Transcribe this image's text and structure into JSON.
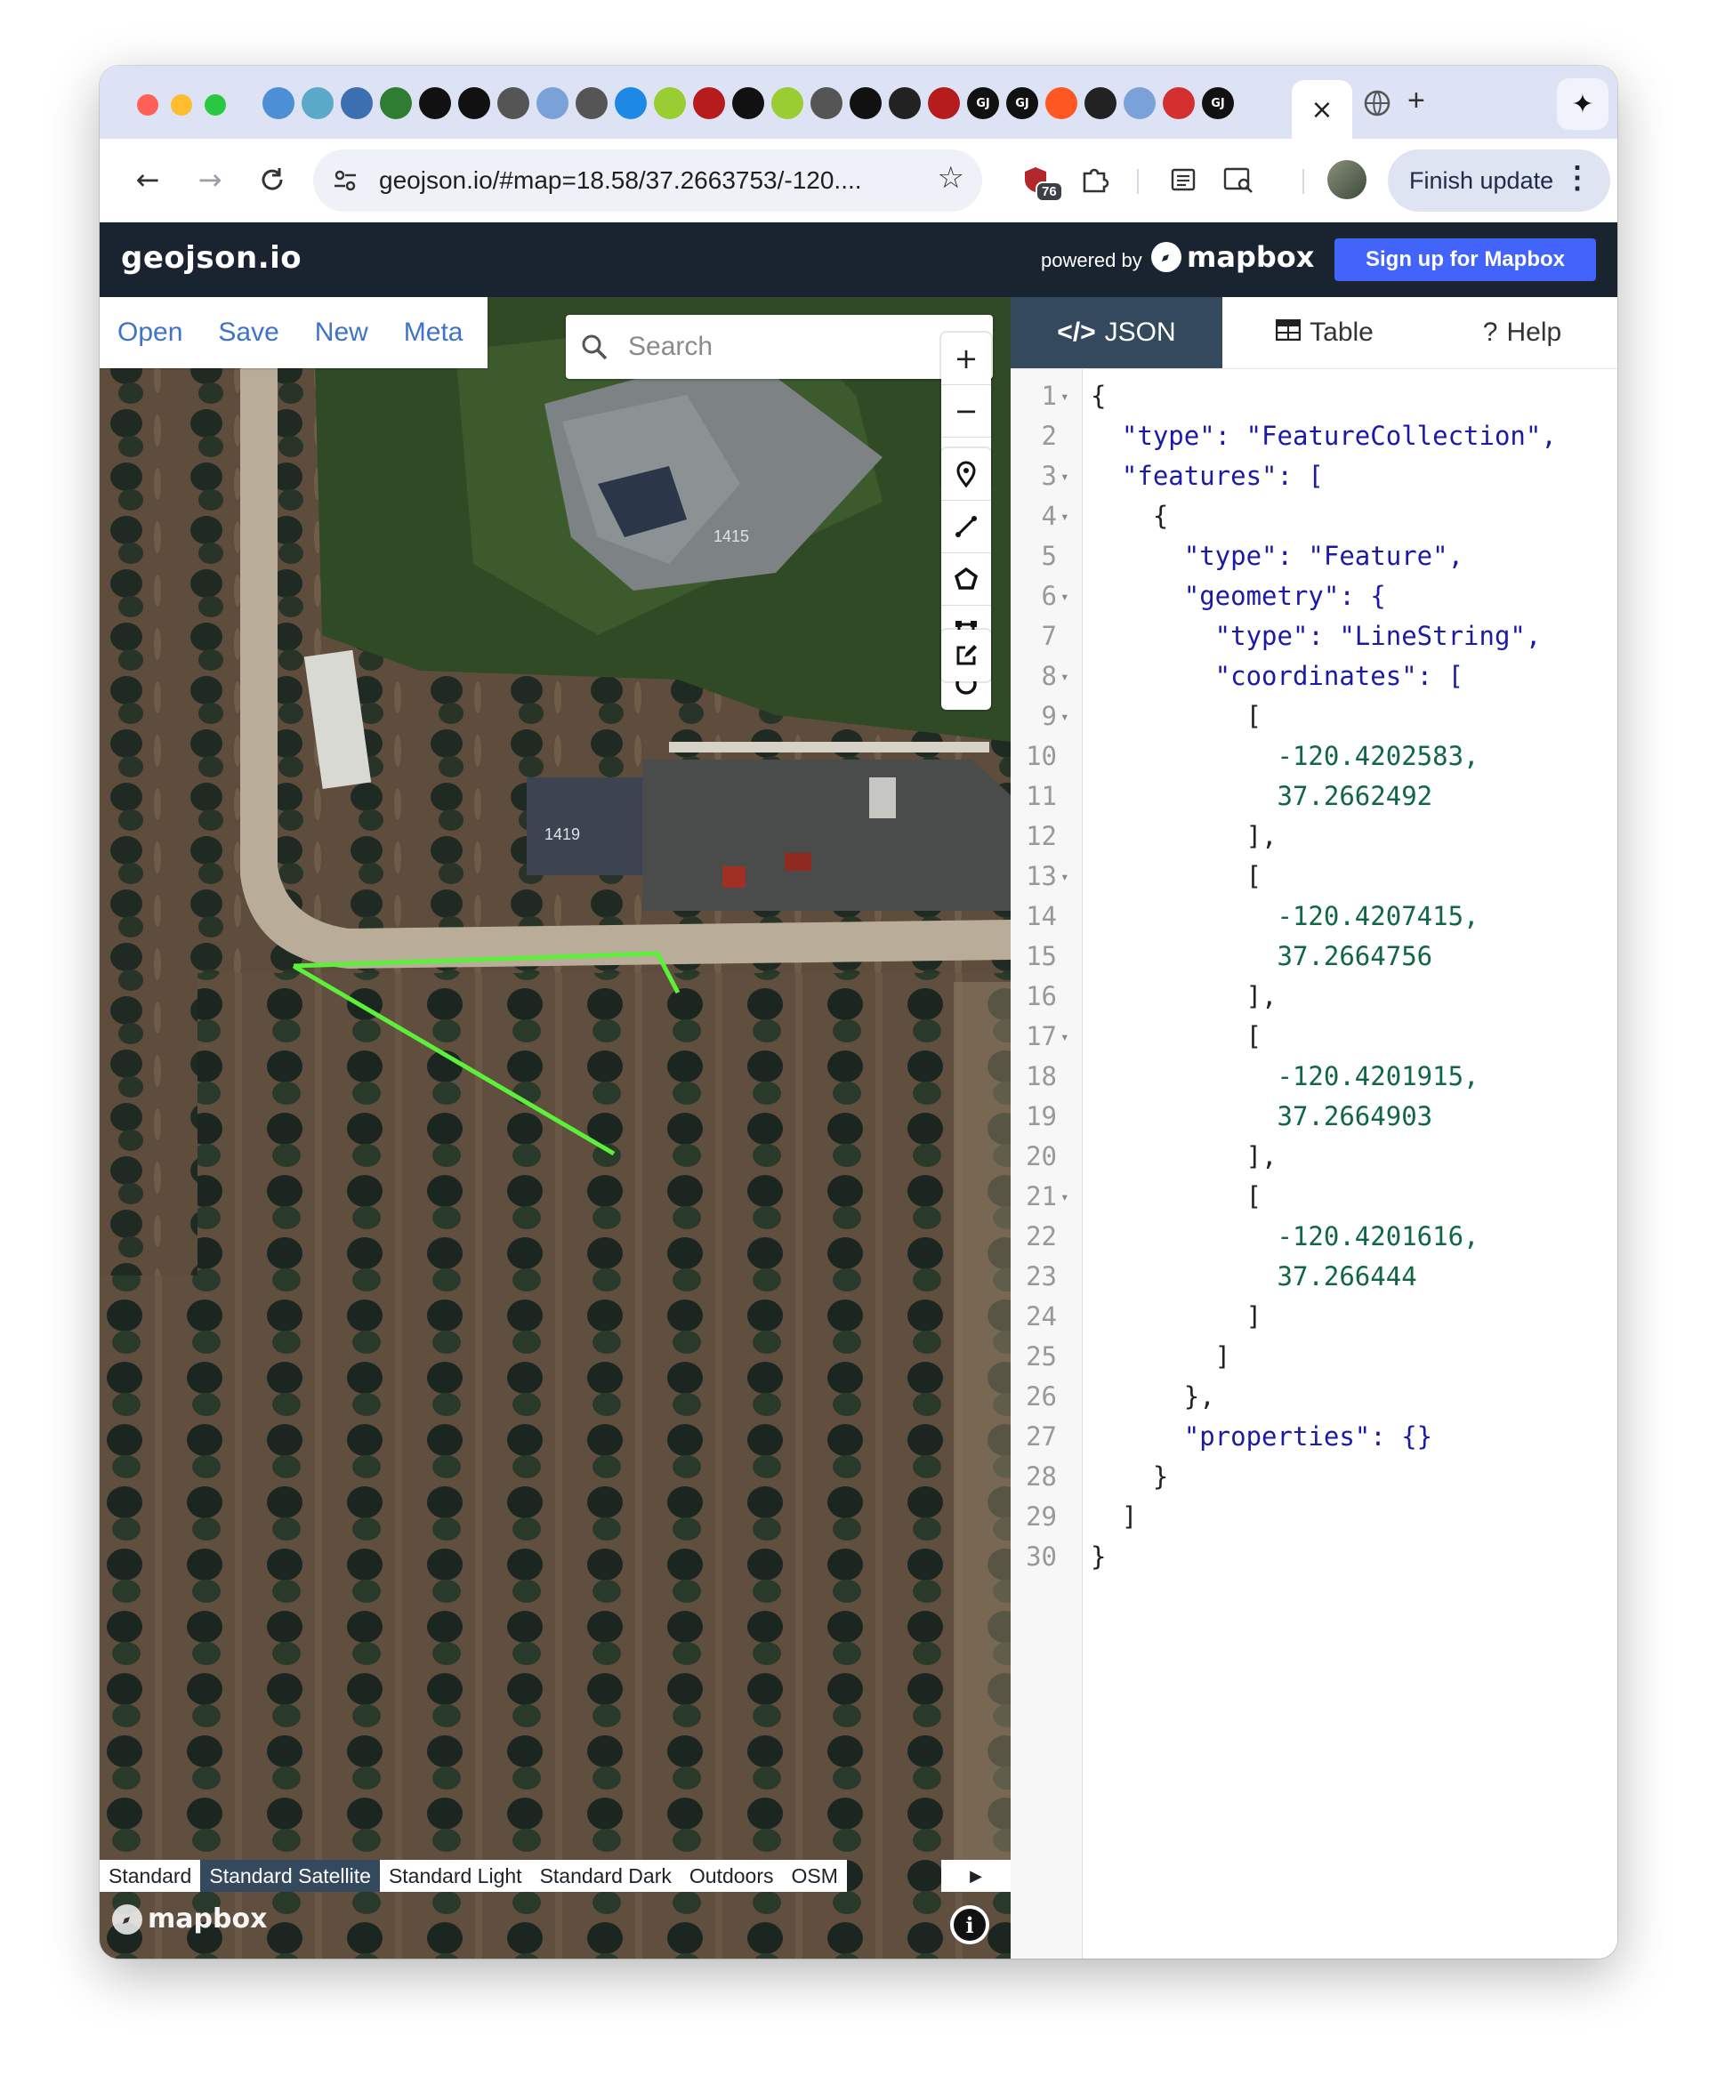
{
  "browser": {
    "tabs": {
      "icons": [
        "tab-icon",
        "tab-icon",
        "tab-icon",
        "tab-icon",
        "tab-icon",
        "tab-icon",
        "tab-icon",
        "tab-icon",
        "tab-icon",
        "tab-icon",
        "tab-icon",
        "tab-icon",
        "tab-icon",
        "tab-icon",
        "tab-icon",
        "tab-icon",
        "tab-icon",
        "tab-icon",
        "tab-icon",
        "tab-icon",
        "tab-icon",
        "tab-icon",
        "tab-icon",
        "tab-icon",
        "tab-icon"
      ],
      "gj_label": "GJ",
      "active_close": "×",
      "new_tab": "+"
    },
    "address": "geojson.io/#map=18.58/37.2663753/-120....",
    "extension_badge": "76",
    "finish_update": "Finish update"
  },
  "app": {
    "title": "geojson.io",
    "powered_by": "powered by",
    "mapbox": "mapbox",
    "signup": "Sign up for Mapbox",
    "file_menu": [
      "Open",
      "Save",
      "New",
      "Meta"
    ],
    "search_placeholder": "Search",
    "map_labels": {
      "house_a": "1415",
      "house_b": "1419"
    },
    "layers": [
      "Standard",
      "Standard Satellite",
      "Standard Light",
      "Standard Dark",
      "Outdoors",
      "OSM"
    ],
    "active_layer": "Standard Satellite",
    "line_color": "#5cf03a",
    "panel_tabs": {
      "json": "JSON",
      "table": "Table",
      "help": "Help"
    },
    "active_panel_tab": "JSON"
  },
  "code": {
    "lines": [
      {
        "n": "1",
        "fold": true,
        "t": "{"
      },
      {
        "n": "2",
        "fold": false,
        "t": "  \"type\": \"FeatureCollection\","
      },
      {
        "n": "3",
        "fold": true,
        "t": "  \"features\": ["
      },
      {
        "n": "4",
        "fold": true,
        "t": "    {"
      },
      {
        "n": "5",
        "fold": false,
        "t": "      \"type\": \"Feature\","
      },
      {
        "n": "6",
        "fold": true,
        "t": "      \"geometry\": {"
      },
      {
        "n": "7",
        "fold": false,
        "t": "        \"type\": \"LineString\","
      },
      {
        "n": "8",
        "fold": true,
        "t": "        \"coordinates\": ["
      },
      {
        "n": "9",
        "fold": true,
        "t": "          ["
      },
      {
        "n": "10",
        "fold": false,
        "t": "            -120.4202583,"
      },
      {
        "n": "11",
        "fold": false,
        "t": "            37.2662492"
      },
      {
        "n": "12",
        "fold": false,
        "t": "          ],"
      },
      {
        "n": "13",
        "fold": true,
        "t": "          ["
      },
      {
        "n": "14",
        "fold": false,
        "t": "            -120.4207415,"
      },
      {
        "n": "15",
        "fold": false,
        "t": "            37.2664756"
      },
      {
        "n": "16",
        "fold": false,
        "t": "          ],"
      },
      {
        "n": "17",
        "fold": true,
        "t": "          ["
      },
      {
        "n": "18",
        "fold": false,
        "t": "            -120.4201915,"
      },
      {
        "n": "19",
        "fold": false,
        "t": "            37.2664903"
      },
      {
        "n": "20",
        "fold": false,
        "t": "          ],"
      },
      {
        "n": "21",
        "fold": true,
        "t": "          ["
      },
      {
        "n": "22",
        "fold": false,
        "t": "            -120.4201616,"
      },
      {
        "n": "23",
        "fold": false,
        "t": "            37.266444"
      },
      {
        "n": "24",
        "fold": false,
        "t": "          ]"
      },
      {
        "n": "25",
        "fold": false,
        "t": "        ]"
      },
      {
        "n": "26",
        "fold": false,
        "t": "      },"
      },
      {
        "n": "27",
        "fold": false,
        "t": "      \"properties\": {}"
      },
      {
        "n": "28",
        "fold": false,
        "t": "    }"
      },
      {
        "n": "29",
        "fold": false,
        "t": "  ]"
      },
      {
        "n": "30",
        "fold": false,
        "t": "}"
      }
    ]
  }
}
